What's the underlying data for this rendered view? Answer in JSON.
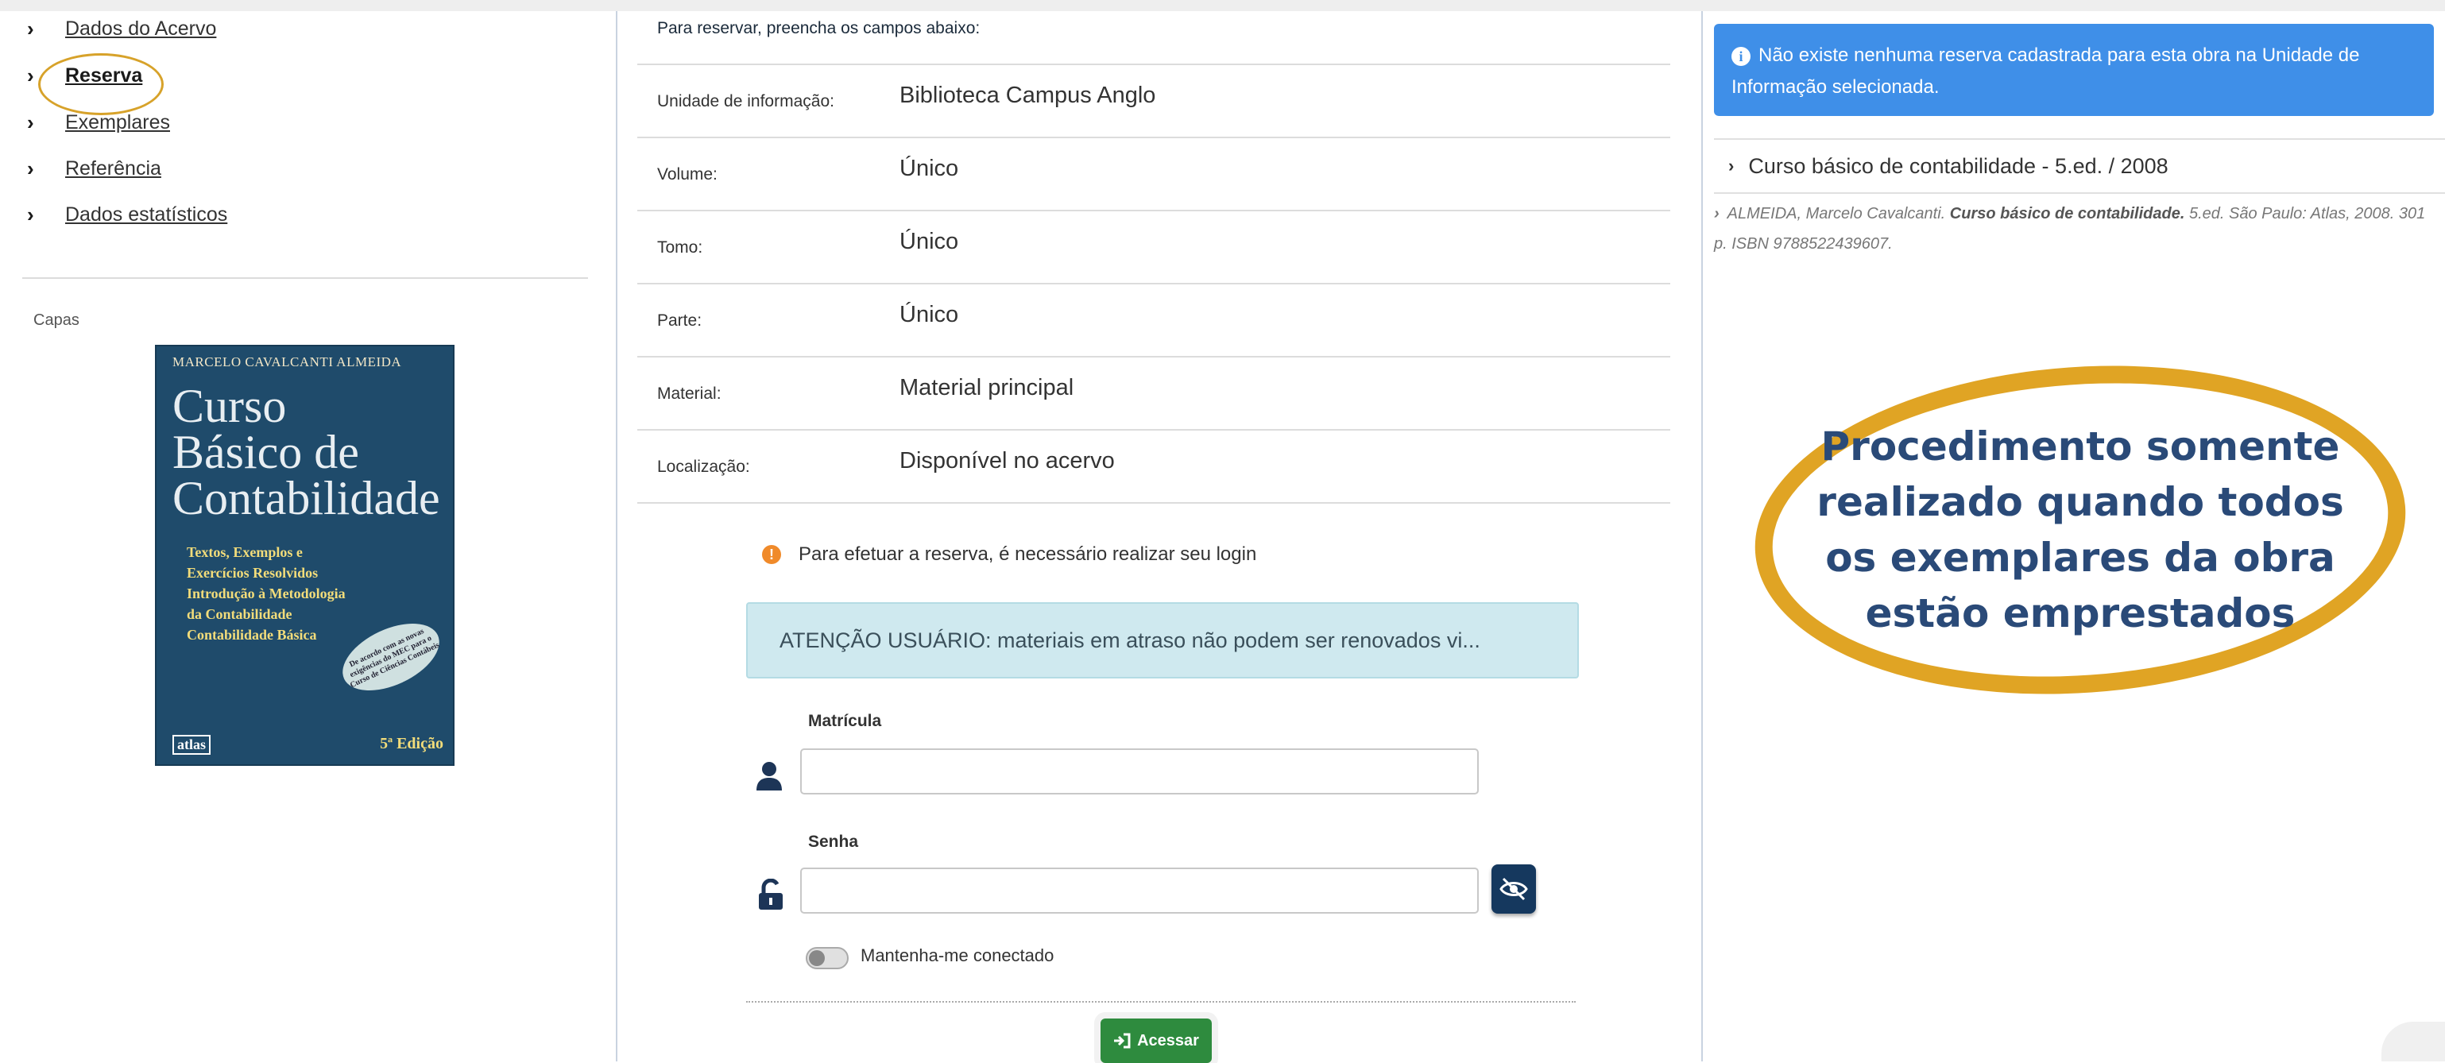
{
  "nav": {
    "items": [
      {
        "label": "Dados do Acervo"
      },
      {
        "label": "Reserva"
      },
      {
        "label": "Exemplares"
      },
      {
        "label": "Referência"
      },
      {
        "label": "Dados estatísticos"
      }
    ],
    "chevron": "›"
  },
  "capas": {
    "label": "Capas"
  },
  "cover": {
    "author": "MARCELO CAVALCANTI ALMEIDA",
    "title_lines": [
      "Curso",
      "Básico de",
      "Contabilidade"
    ],
    "sub_lines": [
      "Textos, Exemplos e",
      "Exercícios Resolvidos",
      "Introdução à Metodologia",
      "da Contabilidade",
      "Contabilidade Básica"
    ],
    "seal": "De acordo com as novas exigências do MEC para o Curso de Ciências Contábeis",
    "edition": "5ª Edição",
    "publisher": "atlas"
  },
  "form": {
    "heading": "Para reservar, preencha os campos abaixo:",
    "rows": [
      {
        "key": "Unidade de informação:",
        "value": "Biblioteca Campus Anglo"
      },
      {
        "key": "Volume:",
        "value": "Único"
      },
      {
        "key": "Tomo:",
        "value": "Único"
      },
      {
        "key": "Parte:",
        "value": "Único"
      },
      {
        "key": "Material:",
        "value": "Material principal"
      },
      {
        "key": "Localização:",
        "value": "Disponível no acervo"
      }
    ],
    "login_notice": "Para efetuar a reserva, é necessário realizar seu login",
    "alert": "ATENÇÃO USUÁRIO: materiais em atraso não podem ser renovados vi...",
    "matricula_label": "Matrícula",
    "matricula_value": "",
    "senha_label": "Senha",
    "senha_value": "",
    "remember_label": "Mantenha-me conectado",
    "submit_label": "Acessar"
  },
  "right": {
    "info": "Não existe nenhuma reserva cadastrada para esta obra na Unidade de Informação selecionada.",
    "ref_title": "Curso básico de contabilidade - 5.ed. / 2008",
    "ref_author": "ALMEIDA, Marcelo Cavalcanti.",
    "ref_book": "Curso básico de contabilidade.",
    "ref_rest": "5.ed. São Paulo: Atlas, 2008. 301 p. ISBN 9788522439607."
  },
  "callout": {
    "text": "Procedimento somente realizado quando todos os exemplares da obra estão emprestados"
  },
  "colors": {
    "accent_ring": "#e0a424",
    "info_blue": "#3f8fe8",
    "submit_green": "#2e8b3e",
    "dark_navy": "#15385e"
  },
  "icons": [
    "chevron-right-icon",
    "warning-icon",
    "user-icon",
    "unlock-icon",
    "eye-slash-icon",
    "sign-in-icon",
    "info-icon"
  ]
}
